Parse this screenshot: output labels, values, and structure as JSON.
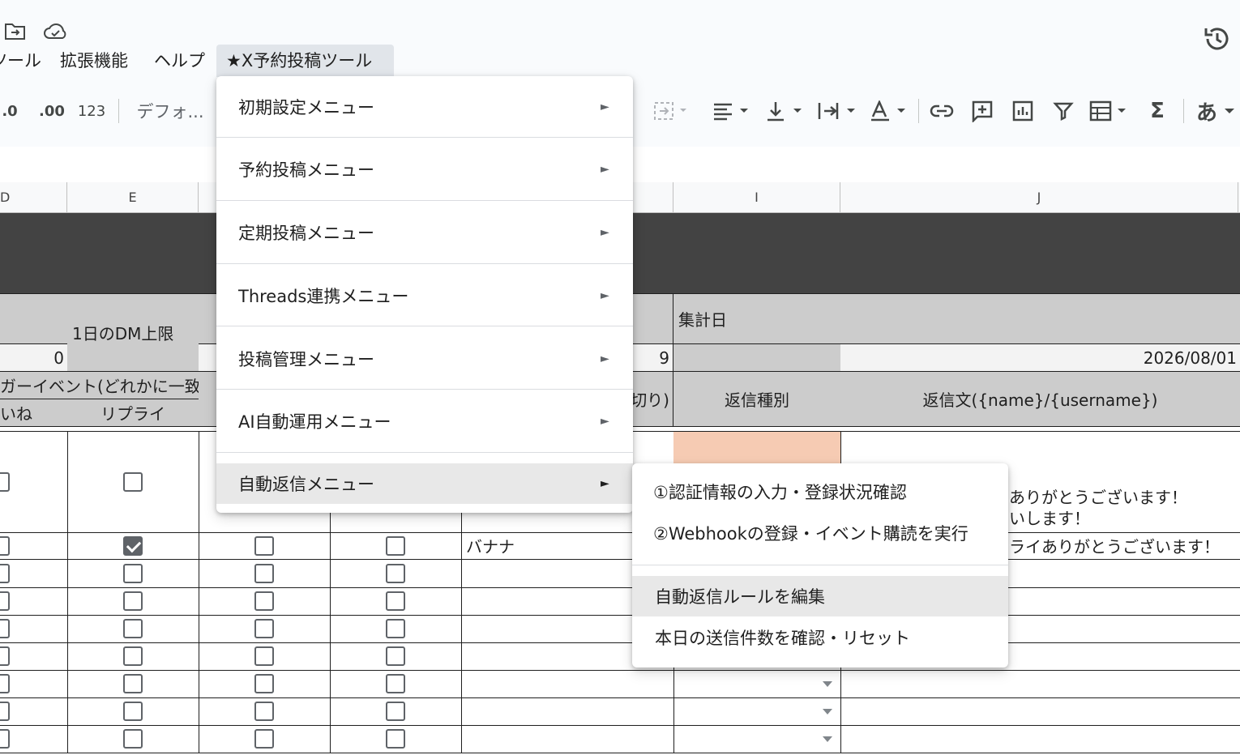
{
  "menubar": {
    "items": [
      {
        "label": "ツール"
      },
      {
        "label": "拡張機能"
      },
      {
        "label": "ヘルプ"
      },
      {
        "label": "★X予約投稿ツール"
      }
    ]
  },
  "toolbar": {
    "decrease_decimal": ".0",
    "increase_decimal": ".00",
    "number_format": "123",
    "font_name": "デフォ...",
    "input_tool_label": "あ"
  },
  "columns": [
    "D",
    "E",
    "I",
    "J"
  ],
  "sheet": {
    "dm_limit_label": "1日のDM上限",
    "dm_limit_value": "0",
    "trigger_header": "ガーイベント(どれかに一致",
    "like_header": "いね",
    "reply_header": "リプライ",
    "h_value": "9",
    "h_header_partial": "切り)",
    "summary_date_label": "集計日",
    "summary_date_value": "2026/08/01",
    "reply_type_header": "返信種別",
    "reply_text_header": "返信文({name}/{username})",
    "row1_reply_line1": "ありがとうございます！",
    "row1_reply_line2": "いします！",
    "row2_keyword": "バナナ",
    "row2_reply": "ライありがとうございます！"
  },
  "menu": {
    "items": [
      {
        "label": "初期設定メニュー"
      },
      {
        "label": "予約投稿メニュー"
      },
      {
        "label": "定期投稿メニュー"
      },
      {
        "label": "Threads連携メニュー"
      },
      {
        "label": "投稿管理メニュー"
      },
      {
        "label": "AI自動運用メニュー"
      },
      {
        "label": "自動返信メニュー"
      }
    ],
    "arrow": "►"
  },
  "submenu": {
    "items": [
      {
        "label": "①認証情報の入力・登録状況確認"
      },
      {
        "label": "②Webhookの登録・イベント購読を実行"
      },
      {
        "label": "自動返信ルールを編集"
      },
      {
        "label": "本日の送信件数を確認・リセット"
      }
    ]
  }
}
